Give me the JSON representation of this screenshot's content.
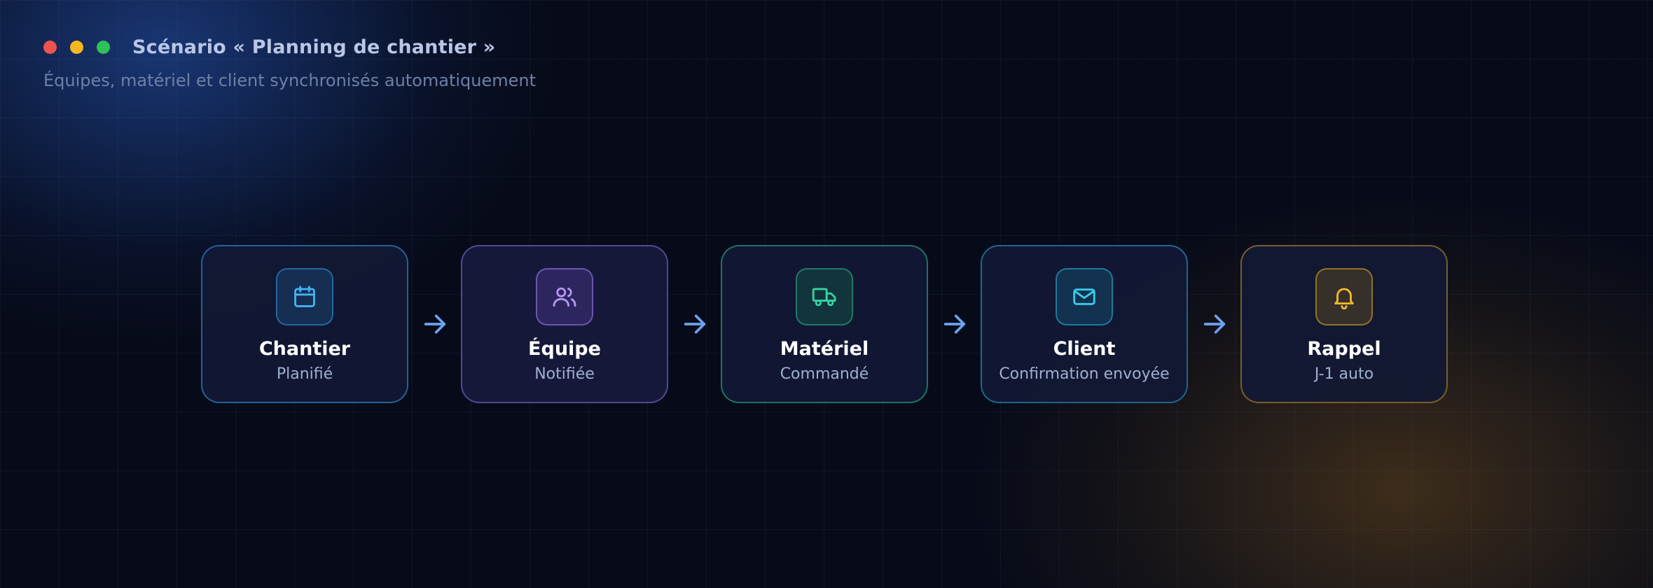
{
  "header": {
    "title": "Scénario « Planning de chantier »",
    "subtitle": "Équipes, matériel et client synchronisés automatiquement"
  },
  "window_dots": [
    "#ef5350",
    "#f4b720",
    "#2fbf5b"
  ],
  "steps": [
    {
      "title": "Chantier",
      "status": "Planifié",
      "icon": "calendar-icon",
      "accent": "#2f8fd8"
    },
    {
      "title": "Équipe",
      "status": "Notifiée",
      "icon": "users-icon",
      "accent": "#9a7de8"
    },
    {
      "title": "Matériel",
      "status": "Commandé",
      "icon": "truck-icon",
      "accent": "#2bb58a"
    },
    {
      "title": "Client",
      "status": "Confirmation envoyée",
      "icon": "mail-icon",
      "accent": "#29b6d8"
    },
    {
      "title": "Rappel",
      "status": "J-1 auto",
      "icon": "bell-icon",
      "accent": "#e0a91f"
    }
  ],
  "arrow_color": "#6ea2f0"
}
